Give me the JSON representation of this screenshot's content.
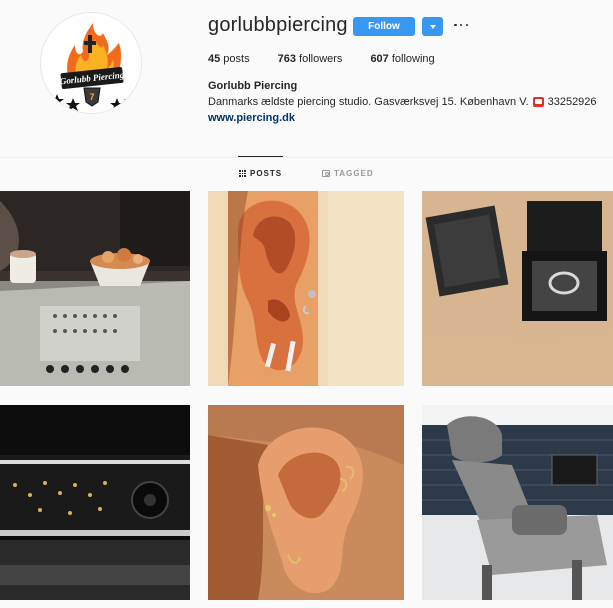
{
  "profile": {
    "username": "gorlubbpiercing",
    "follow_label": "Follow",
    "posts_count": "45",
    "posts_label": " posts",
    "followers_count": "763",
    "followers_label": " followers",
    "following_count": "607",
    "following_label": " following",
    "full_name": "Gorlubb Piercing",
    "bio_text": "Danmarks ældste piercing studio. Gasværksvej 15. København V.",
    "bio_phone_icon": "telephone-icon",
    "bio_phone": "33252926",
    "website": "www.piercing.dk",
    "avatar_icon": "flame-skull-logo",
    "avatar_logo_text": "Gorlubb Piercing"
  },
  "tabs": [
    {
      "label": "POSTS",
      "icon": "grid-icon",
      "active": true
    },
    {
      "label": "TAGGED",
      "icon": "tag-icon",
      "active": false
    }
  ],
  "photos": [
    {
      "subject": "studio counter with jewelry display and mug"
    },
    {
      "subject": "ear with tragus and lobe piercings"
    },
    {
      "subject": "jewelry boxes with ring"
    },
    {
      "subject": "illuminated jewelry display case"
    },
    {
      "subject": "ear with helix and conch piercings"
    },
    {
      "subject": "grey treatment chair in studio"
    }
  ],
  "colors": {
    "accent": "#3897f0",
    "text": "#262626",
    "link": "#003569",
    "background": "#fafafa"
  }
}
